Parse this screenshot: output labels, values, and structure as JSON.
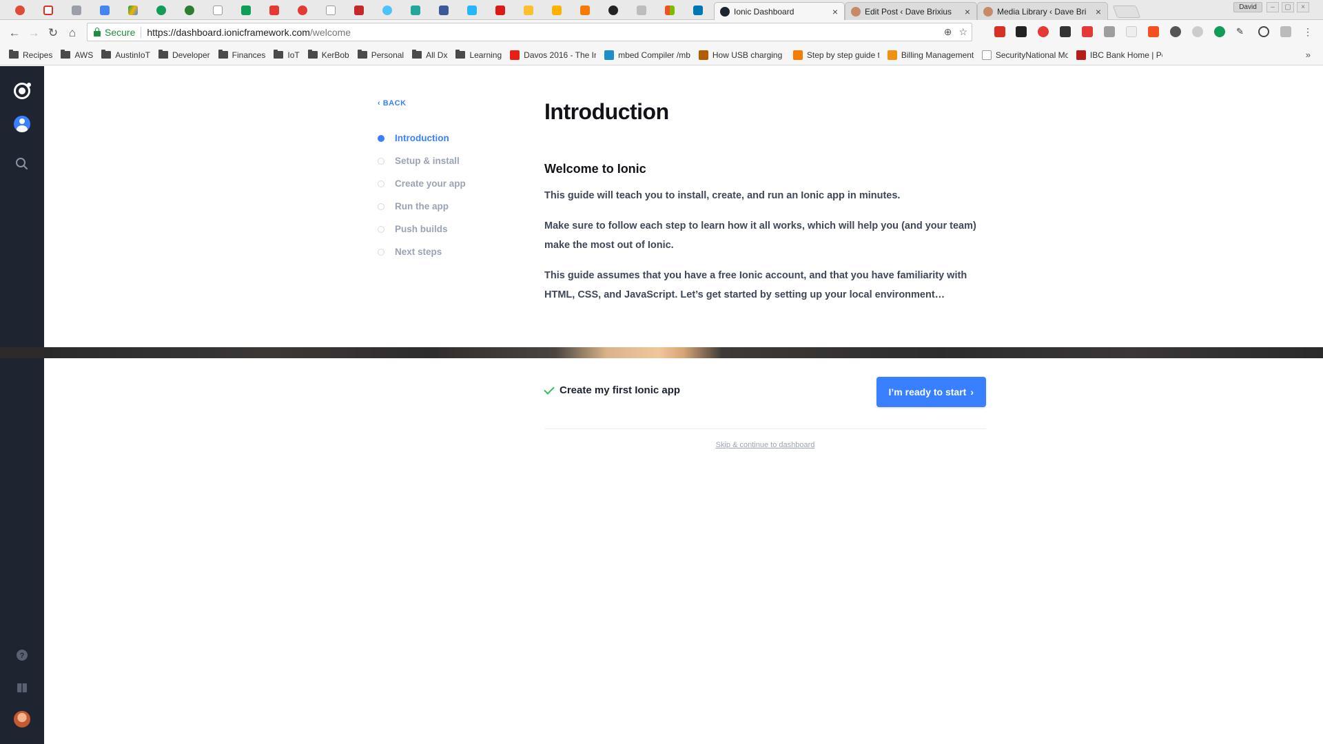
{
  "browser": {
    "active_tab": "Ionic Dashboard",
    "other_tabs": [
      "Edit Post ‹ Dave Brixius",
      "Media Library ‹ Dave Bri"
    ],
    "profile_name": "David",
    "secure_label": "Secure",
    "url_scheme_host": "https://dashboard.ionicframework.com",
    "url_path": "/welcome",
    "bookmarks": [
      "Recipes",
      "AWS",
      "AustinIoT",
      "Developer",
      "Finances",
      "IoT",
      "KerBob",
      "Personal",
      "All Dx",
      "Learning",
      "Davos 2016 - The In",
      "mbed Compiler /mb",
      "How USB charging v",
      "Step by step guide t",
      "Billing Management",
      "SecurityNational Mo",
      "IBC Bank Home | Pe"
    ]
  },
  "guide": {
    "back_label": "BACK",
    "steps": [
      "Introduction",
      "Setup & install",
      "Create your app",
      "Run the app",
      "Push builds",
      "Next steps"
    ],
    "active_step_index": 0,
    "title": "Introduction",
    "section_title": "Welcome to Ionic",
    "paragraphs": [
      "This guide will teach you to install, create, and run an Ionic app in minutes.",
      "Make sure to follow each step to learn how it all works, which will help you (and your team) make the most out of Ionic.",
      "This guide assumes that you have a free Ionic account, and that you have familiarity with HTML, CSS, and JavaScript. Let’s get started by setting up your local environment…"
    ]
  },
  "cta": {
    "task_label": "Create my first Ionic app",
    "start_label": "I’m ready to start",
    "skip_label": "Skip & continue to dashboard"
  },
  "colors": {
    "accent": "#3880ff",
    "sidebar": "#1e2430",
    "success": "#2dbf5a"
  }
}
